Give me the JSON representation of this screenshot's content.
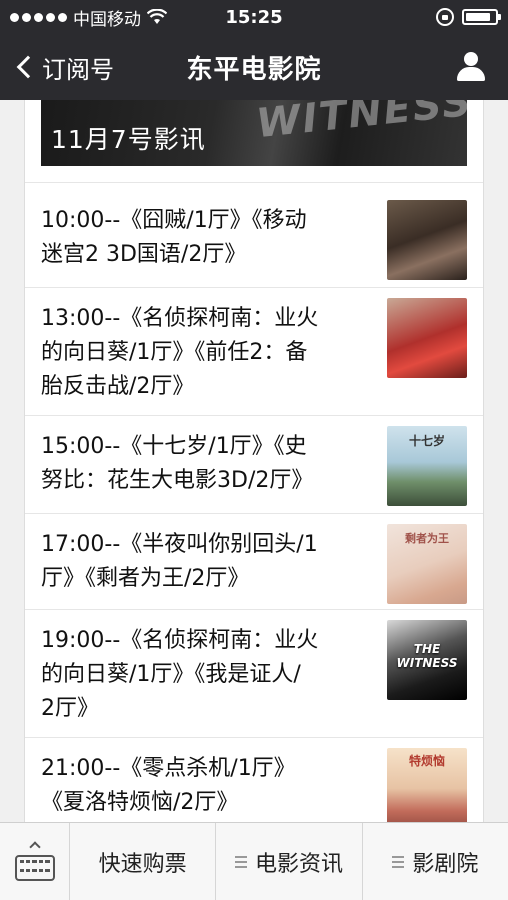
{
  "status_bar": {
    "carrier": "中国移动",
    "time": "15:25",
    "battery_level": 0.85
  },
  "nav": {
    "back_label": "订阅号",
    "title": "东平电影院"
  },
  "banner": {
    "title": "11月7号影讯",
    "decor_text": "WITNESS"
  },
  "schedule": [
    {
      "line1": "10:00--《囧贼/1厅》《移动",
      "line2": "迷宫2  3D国语/2厅》",
      "line3": ""
    },
    {
      "line1": "13:00--《名侦探柯南：业火",
      "line2": "的向日葵/1厅》《前任2：备",
      "line3": "胎反击战/2厅》"
    },
    {
      "line1": "15:00--《十七岁/1厅》《史",
      "line2": "努比：花生大电影3D/2厅》",
      "line3": ""
    },
    {
      "line1": "17:00--《半夜叫你别回头/1",
      "line2": "厅》《剩者为王/2厅》",
      "line3": ""
    },
    {
      "line1": "19:00--《名侦探柯南：业火",
      "line2": "的向日葵/1厅》《我是证人/",
      "line3": "2厅》"
    },
    {
      "line1": "21:00--《零点杀机/1厅》",
      "line2": "《夏洛特烦恼/2厅》",
      "line3": ""
    }
  ],
  "posters": [
    "",
    "",
    "十七岁",
    "剩者为王",
    "THE WITNESS",
    "特烦恼"
  ],
  "bottom_menu": {
    "item1": "快速购票",
    "item2": "电影资讯",
    "item3": "影剧院"
  }
}
